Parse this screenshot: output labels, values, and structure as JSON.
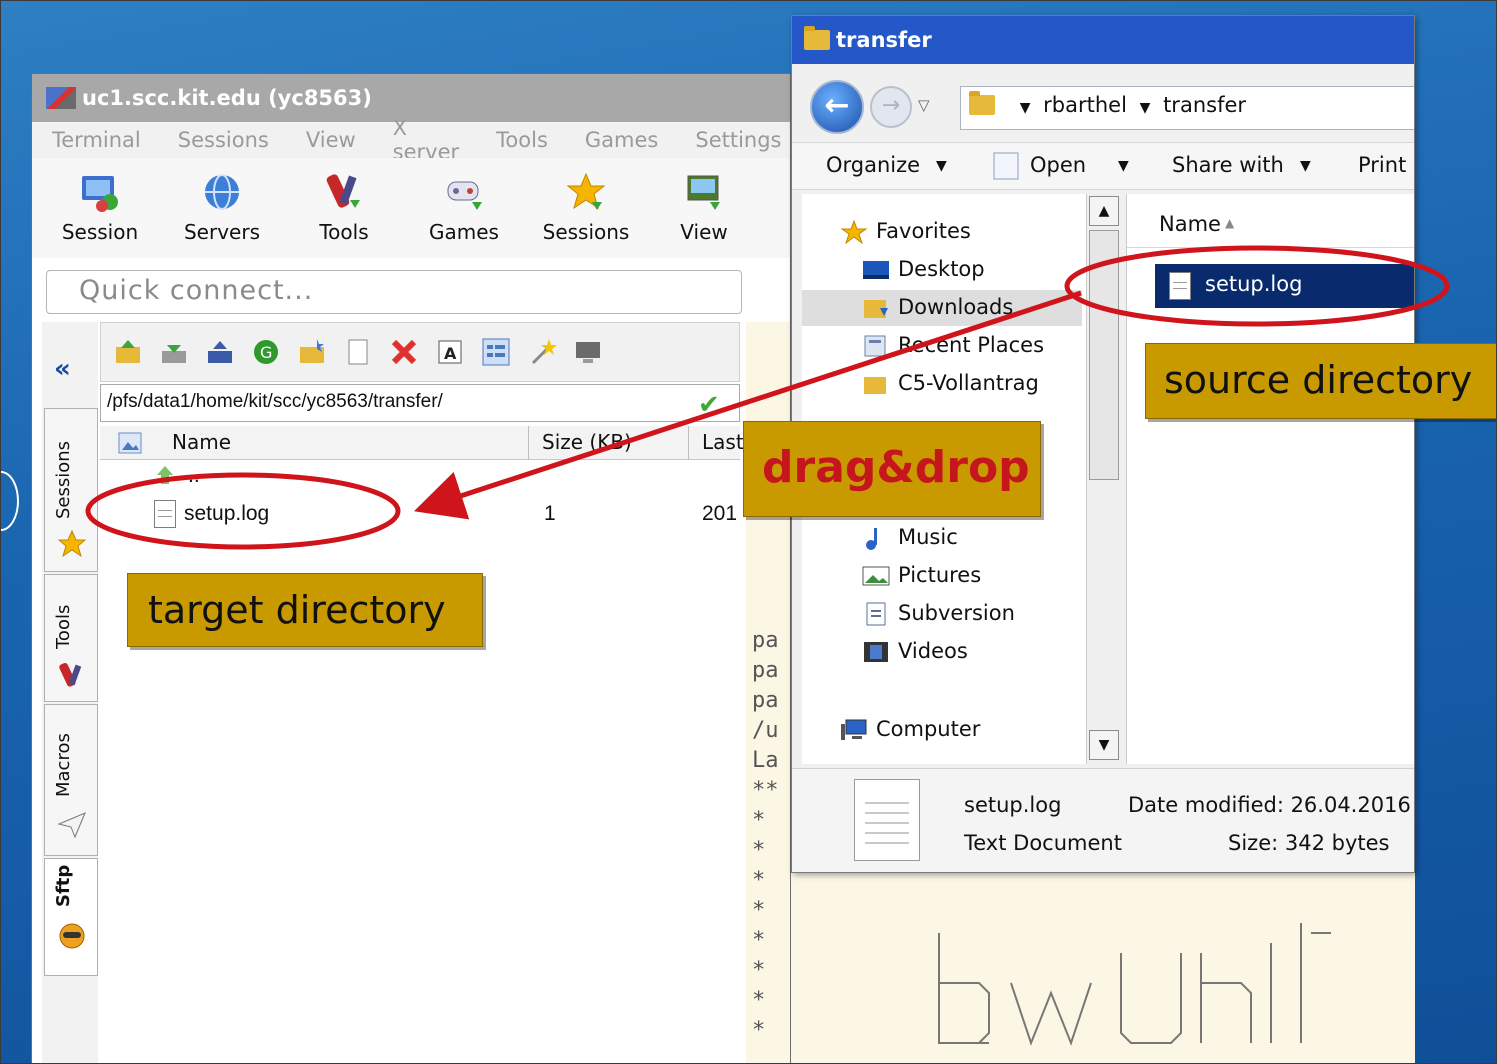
{
  "moba": {
    "title": "uc1.scc.kit.edu (yc8563)",
    "menu": [
      "Terminal",
      "Sessions",
      "View",
      "X server",
      "Tools",
      "Games",
      "Settings"
    ],
    "toolbar": [
      "Session",
      "Servers",
      "Tools",
      "Games",
      "Sessions",
      "View"
    ],
    "quick_connect_placeholder": "Quick connect...",
    "collapse_glyph": "«",
    "side_tabs": [
      "Sessions",
      "Tools",
      "Macros",
      "Sftp"
    ],
    "sftp": {
      "path": "/pfs/data1/home/kit/scc/yc8563/transfer/",
      "columns": [
        "Name",
        "Size (KB)",
        "Last"
      ],
      "rows": [
        {
          "name": "..",
          "size": "",
          "last": ""
        },
        {
          "name": "setup.log",
          "size": "1",
          "last": "201"
        }
      ]
    },
    "terminal_lines": [
      "pa",
      "pa",
      "pa",
      "/u",
      "La",
      "**",
      "*",
      "*",
      "*",
      "*",
      "*",
      "*",
      "*",
      "*"
    ]
  },
  "explorer": {
    "title": "transfer",
    "breadcrumb": [
      "rbarthel",
      "transfer"
    ],
    "commands": [
      "Organize",
      "Open",
      "Share with",
      "Print"
    ],
    "nav": {
      "favorites_label": "Favorites",
      "favorites": [
        "Desktop",
        "Downloads",
        "Recent Places",
        "C5-Vollantrag"
      ],
      "libraries": [
        "Music",
        "Pictures",
        "Subversion",
        "Videos"
      ],
      "computer_label": "Computer"
    },
    "files_header": "Name",
    "files": [
      "setup.log"
    ],
    "details": {
      "name": "setup.log",
      "type": "Text Document",
      "date_modified": "Date modified: 26.04.2016",
      "size": "Size: 342 bytes"
    }
  },
  "annotations": {
    "target": "target directory",
    "source": "source directory",
    "drag": "drag&drop",
    "arrow_color": "#d0141c",
    "callout_color": "#c89a00"
  }
}
